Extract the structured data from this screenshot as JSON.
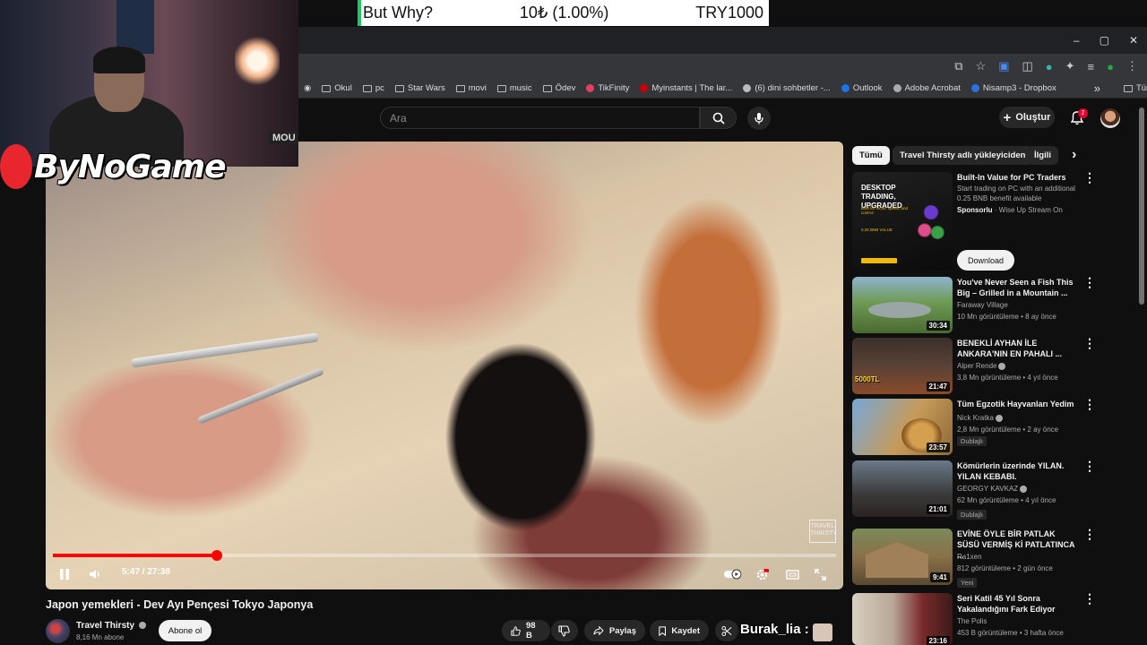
{
  "banner": {
    "name": "But Why?",
    "amount": "10₺ (1.00%)",
    "goal": "TRY1000"
  },
  "stream_logo": {
    "text": "ByNoGame"
  },
  "webcam": {
    "sign": "MOU"
  },
  "browser": {
    "window_controls": [
      "–",
      "▢",
      "✕"
    ],
    "bookmarks": [
      {
        "label": "Okul",
        "icon": "folder-icon"
      },
      {
        "label": "pc",
        "icon": "folder-icon"
      },
      {
        "label": "Star Wars",
        "icon": "folder-icon"
      },
      {
        "label": "movi",
        "icon": "folder-icon"
      },
      {
        "label": "music",
        "icon": "folder-icon"
      },
      {
        "label": "Ödev",
        "icon": "folder-icon"
      },
      {
        "label": "TikFinity",
        "icon": "tikfinity-icon"
      },
      {
        "label": "Myinstants | The lar...",
        "icon": "myinstants-icon"
      },
      {
        "label": "(6) dini sohbetler -...",
        "icon": "site-icon"
      },
      {
        "label": "Outlook",
        "icon": "outlook-icon"
      },
      {
        "label": "Adobe Acrobat",
        "icon": "acrobat-icon"
      },
      {
        "label": "Nisamp3 - Dropbox",
        "icon": "dropbox-icon"
      }
    ],
    "bookmarks_overflow": "»",
    "all_bookmarks": "Tüm Yer İşaretleri"
  },
  "youtube": {
    "search_placeholder": "Ara",
    "create_label": "Oluştur",
    "notification_count": "2"
  },
  "player": {
    "current_time": "5:47",
    "duration": "27:38",
    "time_display": "5:47 / 27:38",
    "progress": 0.209,
    "watermark": "TRAVEL THIRSTY"
  },
  "video": {
    "title": "Japon yemekleri - Dev Ayı Pençesi Tokyo Japonya",
    "channel": "Travel Thirsty",
    "subscribers": "8,16 Mn abone",
    "subscribe_label": "Abone ol",
    "likes": "98 B",
    "share_label": "Paylaş",
    "save_label": "Kaydet"
  },
  "chat_overlay": {
    "name": "Burak_lia",
    "separator": ":"
  },
  "sidebar": {
    "chips": [
      "Tümü",
      "Travel Thirsty adlı yükleyiciden",
      "İlgili"
    ],
    "ad": {
      "title": "Built-In Value for PC Traders",
      "description": "Start trading on PC with an additional 0.25 BNB benefit available",
      "sponsor_label": "Sponsorlu",
      "sponsor": "Wise Up Stream On",
      "cta": "Download",
      "thumb_text": "DESKTOP TRADING, UPGRADED",
      "thumb_sub": "Built for focus, speed, and control.",
      "thumb_value": "0.25 BNB VALUE"
    },
    "recommendations": [
      {
        "title": "You've Never Seen a Fish This Big – Grilled in a Mountain ...",
        "channel": "Faraway Village",
        "verified": false,
        "meta": "10 Mn görüntüleme • 8 ay önce",
        "duration": "30:34",
        "badge": ""
      },
      {
        "title": "BENEKLİ AYHAN İLE ANKARA'NIN EN PAHALI ...",
        "channel": "Alper Rende",
        "verified": true,
        "meta": "3,8 Mn görüntüleme • 4 yıl önce",
        "duration": "21:47",
        "badge": ""
      },
      {
        "title": "Tüm Egzotik Hayvanları Yedim",
        "channel": "Nick Kratka",
        "verified": true,
        "meta": "2,8 Mn görüntüleme • 2 ay önce",
        "duration": "23:57",
        "badge": "Dublajlı"
      },
      {
        "title": "Kömürlerin üzerinde YILAN. YILAN KEBABI.",
        "channel": "GEORGY KAVKAZ",
        "verified": true,
        "meta": "62 Mn görüntüleme • 4 yıl önce",
        "duration": "21:01",
        "badge": "Dublajlı"
      },
      {
        "title": "EVİNE ÖYLE BİR PATLAK SÜSÜ VERMİŞ Kİ PATLATINCA ...",
        "channel": "Ra1xen",
        "verified": false,
        "meta": "812 görüntüleme • 2 gün önce",
        "duration": "9:41",
        "badge": "Yeni"
      },
      {
        "title": "Seri Katil 45 Yıl Sonra Yakalandığını Fark Ediyor",
        "channel": "The Polis",
        "verified": false,
        "meta": "453 B görüntüleme • 3 hafta önce",
        "duration": "23:16",
        "badge": ""
      }
    ]
  }
}
